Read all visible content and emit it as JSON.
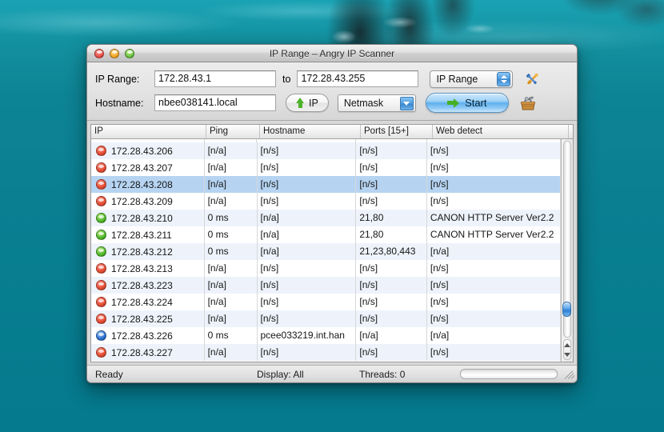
{
  "window": {
    "title": "IP Range – Angry IP Scanner",
    "controls": {
      "close": "close",
      "minimize": "minimize",
      "zoom": "zoom"
    }
  },
  "toolbar": {
    "ip_range_label": "IP Range:",
    "ip_from": "172.28.43.1",
    "ip_to": "172.28.43.255",
    "to_label": "to",
    "hostname_label": "Hostname:",
    "hostname_value": "nbee038141.local",
    "ip_button_label": "IP",
    "feeder_selected": "IP Range",
    "netmask_selected": "Netmask",
    "start_label": "Start",
    "preferences_icon": "tools-icon",
    "fetchers_icon": "toolbox-icon"
  },
  "table": {
    "columns": [
      {
        "key": "ip",
        "label": "IP"
      },
      {
        "key": "ping",
        "label": "Ping"
      },
      {
        "key": "host",
        "label": "Hostname"
      },
      {
        "key": "ports",
        "label": "Ports [15+]"
      },
      {
        "key": "web",
        "label": "Web detect"
      }
    ],
    "rows": [
      {
        "status": "red",
        "ip": "172.28.43.206",
        "ping": "[n/a]",
        "host": "[n/s]",
        "ports": "[n/s]",
        "web": "[n/s]",
        "selected": false
      },
      {
        "status": "red",
        "ip": "172.28.43.207",
        "ping": "[n/a]",
        "host": "[n/s]",
        "ports": "[n/s]",
        "web": "[n/s]",
        "selected": false
      },
      {
        "status": "red",
        "ip": "172.28.43.208",
        "ping": "[n/a]",
        "host": "[n/s]",
        "ports": "[n/s]",
        "web": "[n/s]",
        "selected": true
      },
      {
        "status": "red",
        "ip": "172.28.43.209",
        "ping": "[n/a]",
        "host": "[n/s]",
        "ports": "[n/s]",
        "web": "[n/s]",
        "selected": false
      },
      {
        "status": "green",
        "ip": "172.28.43.210",
        "ping": "0 ms",
        "host": "[n/a]",
        "ports": "21,80",
        "web": "CANON HTTP Server Ver2.2",
        "selected": false
      },
      {
        "status": "green",
        "ip": "172.28.43.211",
        "ping": "0 ms",
        "host": "[n/a]",
        "ports": "21,80",
        "web": "CANON HTTP Server Ver2.2",
        "selected": false
      },
      {
        "status": "green",
        "ip": "172.28.43.212",
        "ping": "0 ms",
        "host": "[n/a]",
        "ports": "21,23,80,443",
        "web": "[n/a]",
        "selected": false
      },
      {
        "status": "red",
        "ip": "172.28.43.213",
        "ping": "[n/a]",
        "host": "[n/s]",
        "ports": "[n/s]",
        "web": "[n/s]",
        "selected": false
      },
      {
        "status": "red",
        "ip": "172.28.43.223",
        "ping": "[n/a]",
        "host": "[n/s]",
        "ports": "[n/s]",
        "web": "[n/s]",
        "selected": false
      },
      {
        "status": "red",
        "ip": "172.28.43.224",
        "ping": "[n/a]",
        "host": "[n/s]",
        "ports": "[n/s]",
        "web": "[n/s]",
        "selected": false
      },
      {
        "status": "red",
        "ip": "172.28.43.225",
        "ping": "[n/a]",
        "host": "[n/s]",
        "ports": "[n/s]",
        "web": "[n/s]",
        "selected": false
      },
      {
        "status": "blue",
        "ip": "172.28.43.226",
        "ping": "0 ms",
        "host": "pcee033219.int.han",
        "ports": "[n/a]",
        "web": "[n/a]",
        "selected": false
      },
      {
        "status": "red",
        "ip": "172.28.43.227",
        "ping": "[n/a]",
        "host": "[n/s]",
        "ports": "[n/s]",
        "web": "[n/s]",
        "selected": false
      }
    ]
  },
  "statusbar": {
    "ready": "Ready",
    "display": "Display: All",
    "threads": "Threads: 0"
  },
  "colors": {
    "desktop": "#0b8395",
    "selection": "#b6d4f2",
    "alt_row": "#eef3fb",
    "alive": "#4fb52a",
    "dead": "#e14b32",
    "unknown": "#2a6fce",
    "accent": "#3c87cf"
  }
}
